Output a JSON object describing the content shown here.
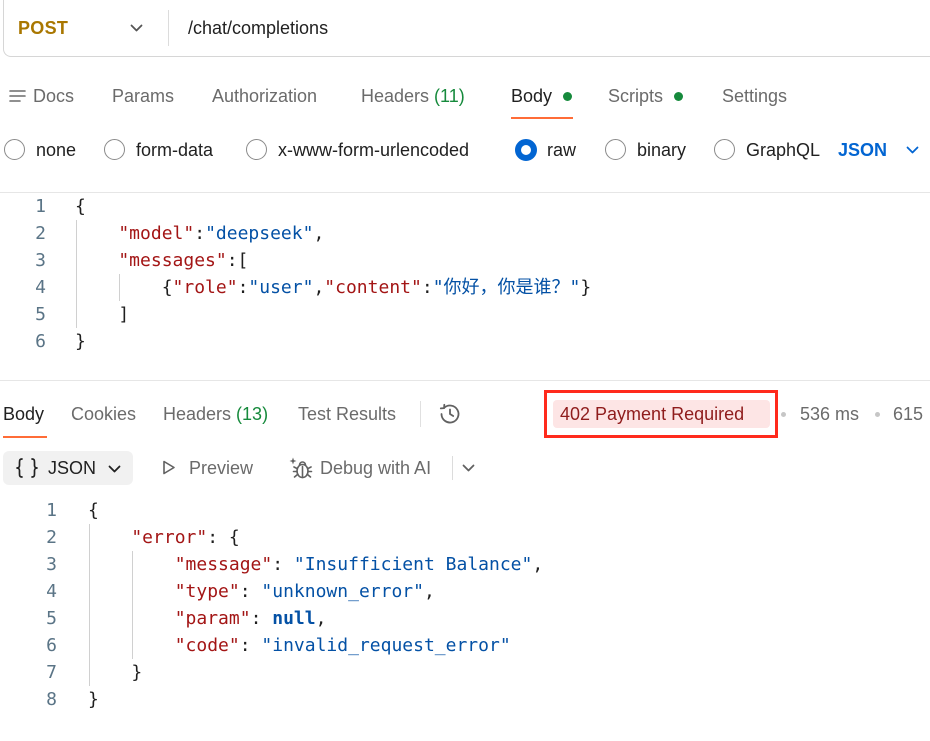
{
  "theme": {
    "accent": "#ff6c37",
    "method": "#a97700",
    "green": "#168a3c",
    "blue": "#0265d2",
    "err-bg": "#fde5e5",
    "err-text": "#8f1c1c",
    "hl": "#ff2a1c",
    "muted": "#6b6b6b"
  },
  "request": {
    "method": "POST",
    "url": "/chat/completions",
    "method_icon": "chevron-down-icon"
  },
  "request_tabs": [
    {
      "label": "Docs",
      "icon": "docs-icon"
    },
    {
      "label": "Params"
    },
    {
      "label": "Authorization"
    },
    {
      "label": "Headers",
      "count": "(11)"
    },
    {
      "label": "Body",
      "active": true,
      "has_content": true
    },
    {
      "label": "Scripts",
      "has_content": true
    },
    {
      "label": "Settings"
    }
  ],
  "body_modes": {
    "options": [
      {
        "label": "none"
      },
      {
        "label": "form-data"
      },
      {
        "label": "x-www-form-urlencoded"
      },
      {
        "label": "raw",
        "selected": true
      },
      {
        "label": "binary"
      },
      {
        "label": "GraphQL"
      }
    ],
    "language": "JSON"
  },
  "request_body": {
    "lines": [
      {
        "n": "1",
        "tokens": [
          {
            "text": "{",
            "color": "#1f1f1f"
          }
        ]
      },
      {
        "n": "2",
        "tokens": [
          {
            "text": "    \"model\"",
            "color": "#a31515"
          },
          {
            "text": ":",
            "color": "#1f1f1f"
          },
          {
            "text": "\"deepseek\"",
            "color": "#0451a5"
          },
          {
            "text": ",",
            "color": "#1f1f1f"
          }
        ]
      },
      {
        "n": "3",
        "tokens": [
          {
            "text": "    \"messages\"",
            "color": "#a31515"
          },
          {
            "text": ":[",
            "color": "#1f1f1f"
          }
        ]
      },
      {
        "n": "4",
        "tokens": [
          {
            "text": "        {",
            "color": "#1f1f1f"
          },
          {
            "text": "\"role\"",
            "color": "#a31515"
          },
          {
            "text": ":",
            "color": "#1f1f1f"
          },
          {
            "text": "\"user\"",
            "color": "#0451a5"
          },
          {
            "text": ",",
            "color": "#1f1f1f"
          },
          {
            "text": "\"content\"",
            "color": "#a31515"
          },
          {
            "text": ":",
            "color": "#1f1f1f"
          },
          {
            "text": "\"你好，你是谁？\"",
            "color": "#0451a5"
          },
          {
            "text": "}",
            "color": "#1f1f1f"
          }
        ]
      },
      {
        "n": "5",
        "tokens": [
          {
            "text": "    ]",
            "color": "#1f1f1f"
          }
        ]
      },
      {
        "n": "6",
        "tokens": [
          {
            "text": "}",
            "color": "#1f1f1f"
          }
        ]
      }
    ]
  },
  "response": {
    "tabs": [
      {
        "label": "Body",
        "active": true
      },
      {
        "label": "Cookies"
      },
      {
        "label": "Headers",
        "count": "(13)"
      },
      {
        "label": "Test Results"
      }
    ],
    "history_icon": "history-icon",
    "status": "402 Payment Required",
    "time": "536 ms",
    "size": "615",
    "format": "JSON",
    "format_icon": "braces-icon",
    "preview_label": "Preview",
    "preview_icon": "play-icon",
    "debug_label": "Debug with AI",
    "debug_icon": "bug-sparkle-icon",
    "lines": [
      {
        "n": "1",
        "tokens": [
          {
            "text": "{",
            "color": "#1f1f1f"
          }
        ]
      },
      {
        "n": "2",
        "tokens": [
          {
            "text": "    \"error\"",
            "color": "#a31515"
          },
          {
            "text": ": {",
            "color": "#1f1f1f"
          }
        ]
      },
      {
        "n": "3",
        "tokens": [
          {
            "text": "        \"message\"",
            "color": "#a31515"
          },
          {
            "text": ": ",
            "color": "#1f1f1f"
          },
          {
            "text": "\"Insufficient Balance\"",
            "color": "#0451a5"
          },
          {
            "text": ",",
            "color": "#1f1f1f"
          }
        ]
      },
      {
        "n": "4",
        "tokens": [
          {
            "text": "        \"type\"",
            "color": "#a31515"
          },
          {
            "text": ": ",
            "color": "#1f1f1f"
          },
          {
            "text": "\"unknown_error\"",
            "color": "#0451a5"
          },
          {
            "text": ",",
            "color": "#1f1f1f"
          }
        ]
      },
      {
        "n": "5",
        "tokens": [
          {
            "text": "        \"param\"",
            "color": "#a31515"
          },
          {
            "text": ": ",
            "color": "#1f1f1f"
          },
          {
            "text": "null",
            "color": "#0451a5",
            "bold": true
          },
          {
            "text": ",",
            "color": "#1f1f1f"
          }
        ]
      },
      {
        "n": "6",
        "tokens": [
          {
            "text": "        \"code\"",
            "color": "#a31515"
          },
          {
            "text": ": ",
            "color": "#1f1f1f"
          },
          {
            "text": "\"invalid_request_error\"",
            "color": "#0451a5"
          }
        ]
      },
      {
        "n": "7",
        "tokens": [
          {
            "text": "    }",
            "color": "#1f1f1f"
          }
        ]
      },
      {
        "n": "8",
        "tokens": [
          {
            "text": "}",
            "color": "#1f1f1f"
          }
        ]
      }
    ]
  }
}
